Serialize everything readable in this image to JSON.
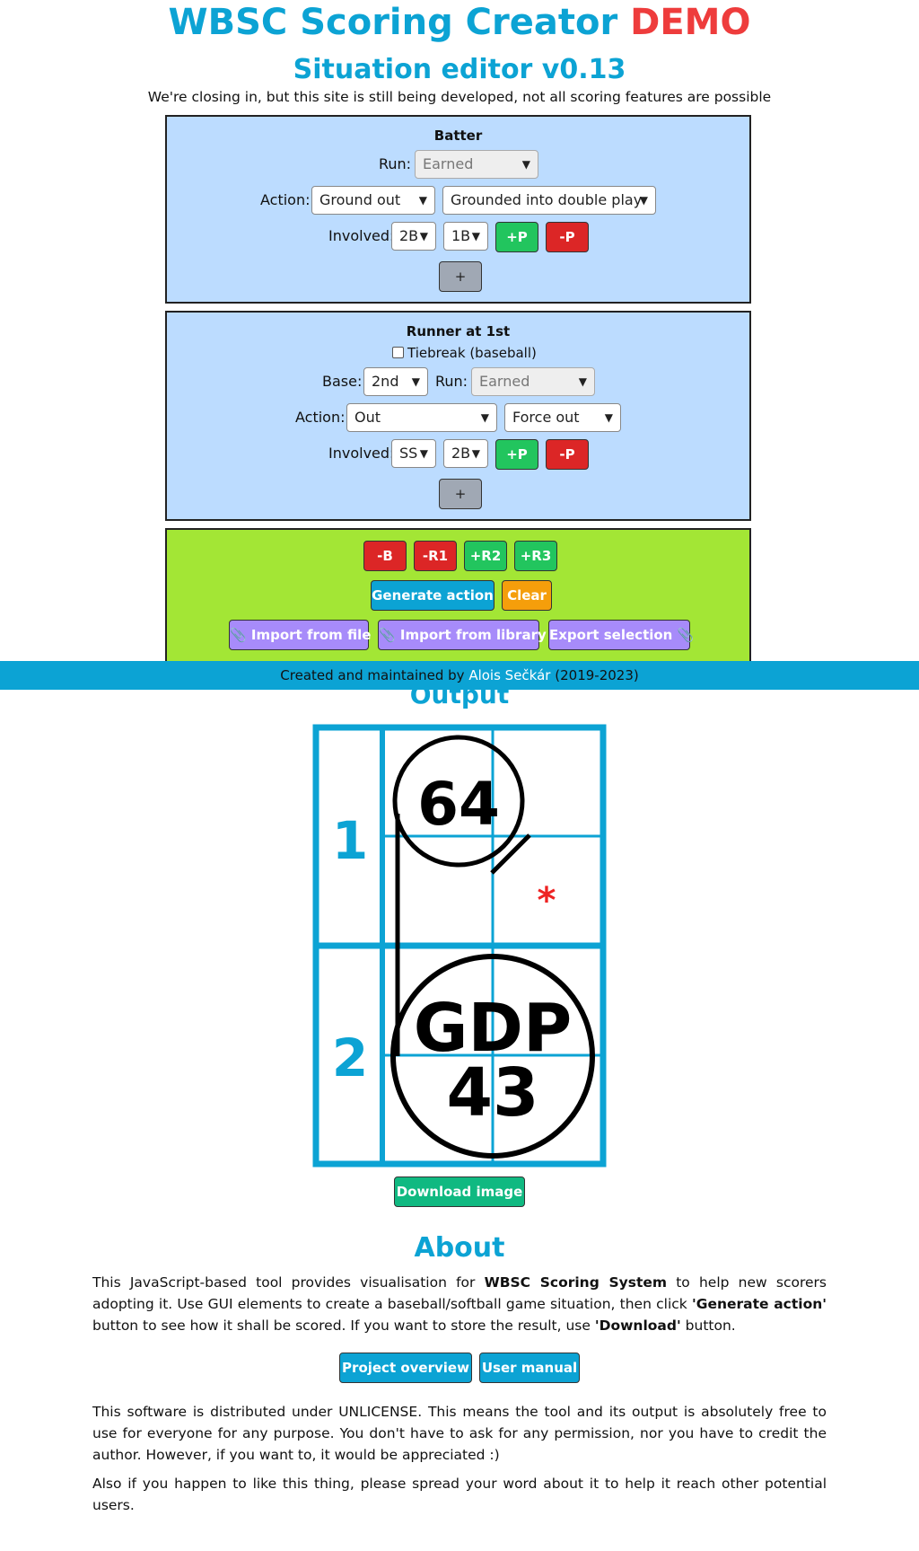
{
  "header": {
    "title_main": "WBSC Scoring Creator",
    "title_demo": "DEMO",
    "subtitle": "Situation editor v0.13",
    "notice": "We're closing in, but this site is still being developed, not all scoring features are possible"
  },
  "batter": {
    "title": "Batter",
    "run_label": "Run:",
    "run_value": "Earned",
    "action_label": "Action:",
    "action_value": "Ground out",
    "action_detail": "Grounded into double play",
    "involved_label": "Involved:",
    "involved": [
      "2B",
      "1B"
    ],
    "plus_p": "+P",
    "minus_p": "-P",
    "add": "+"
  },
  "runner1": {
    "title": "Runner at 1st",
    "tiebreak_label": "Tiebreak (baseball)",
    "tiebreak_checked": false,
    "base_label": "Base:",
    "base_value": "2nd",
    "run_label": "Run:",
    "run_value": "Earned",
    "action_label": "Action:",
    "action_value": "Out",
    "action_detail": "Force out",
    "involved_label": "Involved:",
    "involved": [
      "SS",
      "2B"
    ],
    "plus_p": "+P",
    "minus_p": "-P",
    "add": "+"
  },
  "controls": {
    "remove_batter": "-B",
    "remove_r1": "-R1",
    "add_r2": "+R2",
    "add_r3": "+R3",
    "generate": "Generate action",
    "clear": "Clear",
    "import_file": "📎 Import from file",
    "import_library": "📎 Import from library",
    "export": "Export selection 📎"
  },
  "footer": {
    "prefix": "Created and maintained by",
    "author": "Alois Sečkár",
    "years": "(2019-2023)"
  },
  "output": {
    "title": "Output",
    "row1_number": "1",
    "row1_play": "64",
    "row1_mark": "*",
    "row2_number": "2",
    "row2_play_line1": "GDP",
    "row2_play_line2": "43",
    "download": "Download image"
  },
  "about": {
    "title": "About",
    "p1_a": "This JavaScript-based tool provides visualisation for",
    "p1_b": "WBSC Scoring System",
    "p1_c": "to help new scorers adopting it. Use GUI elements to create a baseball/softball game situation, then click",
    "p1_d": "'Generate action'",
    "p1_e": "button to see how it shall be scored. If you want to store the result, use",
    "p1_f": "'Download'",
    "p1_g": "button.",
    "project_overview": "Project overview",
    "user_manual": "User manual",
    "p2": "This software is distributed under UNLICENSE. This means the tool and its output is absolutely free to use for everyone for any purpose. You don't have to ask for any permission, nor you have to credit the author. However, if you want to, it would be appreciated :)",
    "p3": "Also if you happen to like this thing, please spread your word about it to help it reach other potential users."
  },
  "colors": {
    "accent": "#0ca3d4",
    "demo_red": "#ee3c3c",
    "panel_blue": "#bcdcff",
    "panel_green": "#a3e635"
  }
}
